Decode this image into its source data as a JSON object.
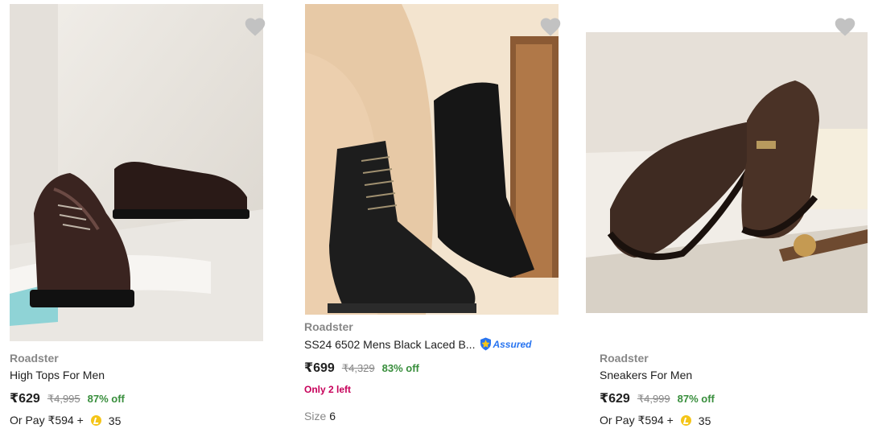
{
  "products": [
    {
      "brand": "Roadster",
      "title": "High Tops For Men",
      "price": "₹629",
      "mrp": "₹4,995",
      "discount": "87% off",
      "or_pay_label": "Or Pay ₹594 +",
      "coins": "35",
      "image_desc": "glossy dark brown lace-up shoes"
    },
    {
      "brand": "Roadster",
      "title": "SS24 6502 Mens Black Laced B...",
      "assured": "Assured",
      "price": "₹699",
      "mrp": "₹4,329",
      "discount": "83% off",
      "stock_note": "Only 2 left",
      "size_label": "Size",
      "size_value": "6",
      "image_desc": "black leather lace-up boots"
    },
    {
      "brand": "Roadster",
      "title": "Sneakers For Men",
      "price": "₹629",
      "mrp": "₹4,999",
      "discount": "87% off",
      "or_pay_label": "Or Pay ₹594 +",
      "coins": "35",
      "image_desc": "brown leather slip-on shoes"
    }
  ],
  "colors": {
    "price_text": "#212121",
    "mrp_text": "#878787",
    "discount_green": "#388e3c",
    "stock_alert": "#c7005a",
    "assured_blue": "#2874f0",
    "coin_yellow": "#f5c518",
    "wishlist_gray": "#c2c2c2"
  },
  "icons": {
    "wishlist": "heart-icon",
    "coin": "supercoin-icon",
    "assured": "assured-shield-icon"
  }
}
